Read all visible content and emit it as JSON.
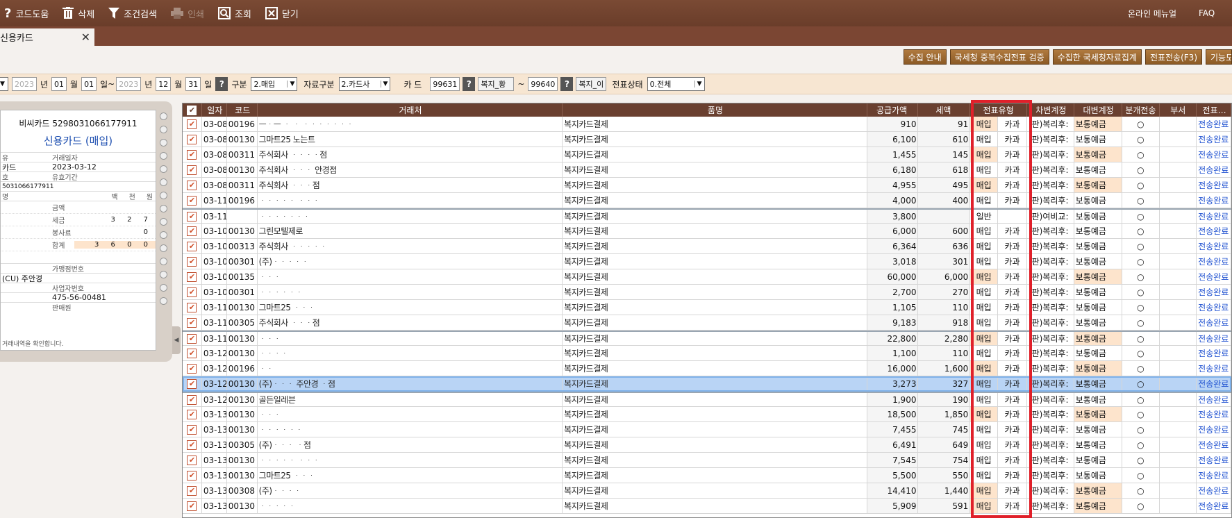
{
  "toolbar": {
    "code_help": "코드도움",
    "delete": "삭제",
    "condition_search": "조건검색",
    "print": "인쇄",
    "lookup": "조회",
    "close": "닫기",
    "online_manual": "온라인 메뉴얼",
    "faq": "FAQ"
  },
  "tab": {
    "label": "신용카드"
  },
  "actions": [
    "수집 안내",
    "국세청 중복수집전표 검증",
    "수집한 국세청자료집계",
    "전표전송(F3)",
    "기능모"
  ],
  "filter": {
    "year1": "2023",
    "year_lbl": "년",
    "month1": "01",
    "month_lbl": "월",
    "day1": "01",
    "day_lbl": "일",
    "tilde": "~",
    "year2": "2023",
    "month2": "12",
    "day2": "31",
    "gubun_lbl": "구분",
    "gubun_val": "2.매입",
    "source_lbl": "자료구분",
    "source_val": "2.카드사",
    "card_lbl": "카 드",
    "card_from_code": "99631",
    "card_from_name": "복지_황",
    "card_to_code": "99640",
    "card_to_name": "복지_이",
    "status_lbl": "전표상태",
    "status_val": "0.전체"
  },
  "card": {
    "head": "비씨카드 5298031066177911",
    "title": "신용카드 (매입)",
    "lbl_type": "유",
    "lbl_date": "거래일자",
    "val_type": "카드",
    "val_date": "2023-03-12",
    "lbl_no": "호",
    "lbl_expiry": "유효기간",
    "val_no": "5031066177911",
    "lbl_unit": "명",
    "units": [
      "백",
      "천",
      "원"
    ],
    "amt_labels": [
      "금액",
      "세금",
      "봉사료",
      "합계"
    ],
    "amt_values": [
      "",
      "3 2 7",
      "0",
      "3 6 0 0"
    ],
    "lbl_merchant": "가맹점번호",
    "val_merchant": "(CU) 주안경",
    "lbl_bizno": "사업자번호",
    "val_bizno": "475-56-00481",
    "lbl_seller": "판매원",
    "note": "거래내역을 확인합니다."
  },
  "grid": {
    "headers": {
      "date": "일자",
      "code": "코드",
      "vendor": "거래처",
      "item": "품명",
      "supply": "공급가액",
      "tax": "세액",
      "type": "전표유형",
      "debit": "차변계정",
      "credit": "대변계정",
      "split": "분개전송",
      "dept": "부서",
      "trans": "전표…"
    },
    "rows": [
      {
        "date": "03-08",
        "code": "00196",
        "vendor": "ᅳᆞᅳ ᆞ ᆞ ᆞᆞᆞᆞᆞᆞᆞ",
        "item": "복지카드결제",
        "supply": "910",
        "tax": "91",
        "t1": "매입",
        "t2": "카과",
        "debit": "(판)복리후:",
        "credit": "보통예금",
        "split": "○",
        "trans": "전송완료",
        "peach": true
      },
      {
        "date": "03-08",
        "code": "00130",
        "vendor": "그마트25 노는트",
        "item": "복지카드결제",
        "supply": "6,100",
        "tax": "610",
        "t1": "매입",
        "t2": "카과",
        "debit": "(판)복리후:",
        "credit": "보통예금",
        "split": "○",
        "trans": "전송완료",
        "peach": false
      },
      {
        "date": "03-08",
        "code": "00311",
        "vendor": "주식회사 ᆞᆞᆞᆞ점",
        "item": "복지카드결제",
        "supply": "1,455",
        "tax": "145",
        "t1": "매입",
        "t2": "카과",
        "debit": "(판)복리후:",
        "credit": "보통예금",
        "split": "○",
        "trans": "전송완료",
        "peach": true
      },
      {
        "date": "03-08",
        "code": "00130",
        "vendor": "주식회사 ᆞᆞᆞ 안경점",
        "item": "복지카드결제",
        "supply": "6,180",
        "tax": "618",
        "t1": "매입",
        "t2": "카과",
        "debit": "(판)복리후:",
        "credit": "보통예금",
        "split": "○",
        "trans": "전송완료",
        "peach": false
      },
      {
        "date": "03-08",
        "code": "00311",
        "vendor": "주식회사 ᆞᆞᆞ점",
        "item": "복지카드결제",
        "supply": "4,955",
        "tax": "495",
        "t1": "매입",
        "t2": "카과",
        "debit": "(판)복리후:",
        "credit": "보통예금",
        "split": "○",
        "trans": "전송완료",
        "peach": true
      },
      {
        "date": "03-11",
        "code": "00196",
        "vendor": "ᆞᆞᆞᆞᆞ ᆞᆞᆞ",
        "item": "복지카드결제",
        "supply": "4,000",
        "tax": "400",
        "t1": "매입",
        "t2": "카과",
        "debit": "(판)복리후:",
        "credit": "보통예금",
        "split": "○",
        "trans": "전송완료",
        "peach": false
      },
      {
        "date": "03-11",
        "code": "",
        "vendor": "ᆞᆞᆞᆞᆞᆞᆞ",
        "item": "복지카드결제",
        "supply": "3,800",
        "tax": "",
        "t1": "일반",
        "t2": "",
        "debit": "(판)여비교:",
        "credit": "보통예금",
        "split": "○",
        "trans": "전송완료",
        "peach": false
      },
      {
        "date": "03-10",
        "code": "00130",
        "vendor": "그린모텔제로",
        "item": "복지카드결제",
        "supply": "6,000",
        "tax": "600",
        "t1": "매입",
        "t2": "카과",
        "debit": "(판)복리후:",
        "credit": "보통예금",
        "split": "○",
        "trans": "전송완료",
        "peach": false
      },
      {
        "date": "03-10",
        "code": "00313",
        "vendor": "주식회사 ᆞᆞᆞᆞᆞ",
        "item": "복지카드결제",
        "supply": "6,364",
        "tax": "636",
        "t1": "매입",
        "t2": "카과",
        "debit": "(판)복리후:",
        "credit": "보통예금",
        "split": "○",
        "trans": "전송완료",
        "peach": false
      },
      {
        "date": "03-10",
        "code": "00301",
        "vendor": "(주)ᆞᆞᆞᆞᆞ",
        "item": "복지카드결제",
        "supply": "3,018",
        "tax": "301",
        "t1": "매입",
        "t2": "카과",
        "debit": "(판)복리후:",
        "credit": "보통예금",
        "split": "○",
        "trans": "전송완료",
        "peach": false
      },
      {
        "date": "03-10",
        "code": "00135",
        "vendor": "ᆞᆞᆞ",
        "item": "복지카드결제",
        "supply": "60,000",
        "tax": "6,000",
        "t1": "매입",
        "t2": "카과",
        "debit": "(판)복리후:",
        "credit": "보통예금",
        "split": "○",
        "trans": "전송완료",
        "peach": true
      },
      {
        "date": "03-10",
        "code": "00301",
        "vendor": "ᆞᆞᆞᆞᆞᆞ",
        "item": "복지카드결제",
        "supply": "2,700",
        "tax": "270",
        "t1": "매입",
        "t2": "카과",
        "debit": "(판)복리후:",
        "credit": "보통예금",
        "split": "○",
        "trans": "전송완료",
        "peach": false
      },
      {
        "date": "03-11",
        "code": "00130",
        "vendor": "그마트25 ᆞᆞᆞ",
        "item": "복지카드결제",
        "supply": "1,105",
        "tax": "110",
        "t1": "매입",
        "t2": "카과",
        "debit": "(판)복리후:",
        "credit": "보통예금",
        "split": "○",
        "trans": "전송완료",
        "peach": false
      },
      {
        "date": "03-11",
        "code": "00305",
        "vendor": "주식회사 ᆞᆞᆞ점",
        "item": "복지카드결제",
        "supply": "9,183",
        "tax": "918",
        "t1": "매입",
        "t2": "카과",
        "debit": "(판)복리후:",
        "credit": "보통예금",
        "split": "○",
        "trans": "전송완료",
        "peach": false
      },
      {
        "date": "03-11",
        "code": "00130",
        "vendor": "ᆞᆞᆞ",
        "item": "복지카드결제",
        "supply": "22,800",
        "tax": "2,280",
        "t1": "매입",
        "t2": "카과",
        "debit": "(판)복리후:",
        "credit": "보통예금",
        "split": "○",
        "trans": "전송완료",
        "peach": true
      },
      {
        "date": "03-12",
        "code": "00130",
        "vendor": "ᆞᆞᆞᆞ",
        "item": "복지카드결제",
        "supply": "1,100",
        "tax": "110",
        "t1": "매입",
        "t2": "카과",
        "debit": "(판)복리후:",
        "credit": "보통예금",
        "split": "○",
        "trans": "전송완료",
        "peach": false
      },
      {
        "date": "03-12",
        "code": "00196",
        "vendor": "ᆞᆞ",
        "item": "복지카드결제",
        "supply": "16,000",
        "tax": "1,600",
        "t1": "매입",
        "t2": "카과",
        "debit": "(판)복리후:",
        "credit": "보통예금",
        "split": "○",
        "trans": "전송완료",
        "peach": true
      },
      {
        "date": "03-12",
        "code": "00130",
        "vendor": "(주)ᆞᆞᆞ 주안경 ᆞ점",
        "item": "복지카드결제",
        "supply": "3,273",
        "tax": "327",
        "t1": "매입",
        "t2": "카과",
        "debit": "(판)복리후:",
        "credit": "보통예금",
        "split": "○",
        "trans": "전송완료",
        "peach": false,
        "selected": true
      },
      {
        "date": "03-12",
        "code": "00130",
        "vendor": "골든일레븐",
        "item": "복지카드결제",
        "supply": "1,900",
        "tax": "190",
        "t1": "매입",
        "t2": "카과",
        "debit": "(판)복리후:",
        "credit": "보통예금",
        "split": "○",
        "trans": "전송완료",
        "peach": false
      },
      {
        "date": "03-13",
        "code": "00130",
        "vendor": "ᆞᆞᆞ",
        "item": "복지카드결제",
        "supply": "18,500",
        "tax": "1,850",
        "t1": "매입",
        "t2": "카과",
        "debit": "(판)복리후:",
        "credit": "보통예금",
        "split": "○",
        "trans": "전송완료",
        "peach": true
      },
      {
        "date": "03-13",
        "code": "00130",
        "vendor": "ᆞᆞᆞᆞᆞᆞ",
        "item": "복지카드결제",
        "supply": "7,455",
        "tax": "745",
        "t1": "매입",
        "t2": "카과",
        "debit": "(판)복리후:",
        "credit": "보통예금",
        "split": "○",
        "trans": "전송완료",
        "peach": false
      },
      {
        "date": "03-13",
        "code": "00305",
        "vendor": "(주)ᆞᆞᆞ ᆞ점",
        "item": "복지카드결제",
        "supply": "6,491",
        "tax": "649",
        "t1": "매입",
        "t2": "카과",
        "debit": "(판)복리후:",
        "credit": "보통예금",
        "split": "○",
        "trans": "전송완료",
        "peach": false
      },
      {
        "date": "03-13",
        "code": "00130",
        "vendor": "ᆞᆞᆞᆞᆞ ᆞᆞᆞ",
        "item": "복지카드결제",
        "supply": "7,545",
        "tax": "754",
        "t1": "매입",
        "t2": "카과",
        "debit": "(판)복리후:",
        "credit": "보통예금",
        "split": "○",
        "trans": "전송완료",
        "peach": false
      },
      {
        "date": "03-13",
        "code": "00130",
        "vendor": "그마트25 ᆞᆞᆞ",
        "item": "복지카드결제",
        "supply": "5,500",
        "tax": "550",
        "t1": "매입",
        "t2": "카과",
        "debit": "(판)복리후:",
        "credit": "보통예금",
        "split": "○",
        "trans": "전송완료",
        "peach": false
      },
      {
        "date": "03-13",
        "code": "00308",
        "vendor": "(주)ᆞᆞᆞᆞ",
        "item": "복지카드결제",
        "supply": "14,410",
        "tax": "1,440",
        "t1": "매입",
        "t2": "카과",
        "debit": "(판)복리후:",
        "credit": "보통예금",
        "split": "○",
        "trans": "전송완료",
        "peach": true
      },
      {
        "date": "03-13",
        "code": "00130",
        "vendor": "ᆞᆞᆞᆞᆞ",
        "item": "복지카드결제",
        "supply": "5,909",
        "tax": "591",
        "t1": "매입",
        "t2": "카과",
        "debit": "(판)복리후:",
        "credit": "보통예금",
        "split": "○",
        "trans": "전송완료",
        "peach": true
      }
    ]
  }
}
